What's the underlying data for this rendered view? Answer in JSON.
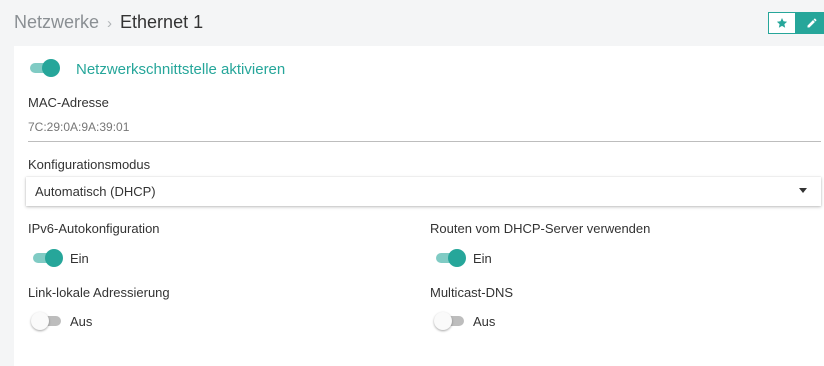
{
  "header": {
    "breadcrumb_root": "Netzwerke",
    "breadcrumb_separator": "›",
    "breadcrumb_current": "Ethernet 1",
    "actions": [
      {
        "name": "favorite",
        "icon": "star-icon"
      },
      {
        "name": "edit",
        "icon": "pencil-icon"
      }
    ]
  },
  "colors": {
    "accent": "#26a69a",
    "accent_light": "#80cbc4",
    "toggle_off": "#bdbdbd"
  },
  "interface": {
    "enable_label": "Netzwerkschnittstelle aktivieren",
    "enabled": true
  },
  "mac": {
    "label": "MAC-Adresse",
    "value": "7C:29:0A:9A:39:01"
  },
  "config_mode": {
    "label": "Konfigurationsmodus",
    "selected": "Automatisch (DHCP)"
  },
  "options": {
    "ipv6": {
      "label": "IPv6-Autokonfiguration",
      "enabled": true,
      "state_text": "Ein"
    },
    "dhcp_routes": {
      "label": "Routen vom DHCP-Server verwenden",
      "enabled": true,
      "state_text": "Ein"
    },
    "link_local": {
      "label": "Link-lokale Adressierung",
      "enabled": false,
      "state_text": "Aus"
    },
    "mdns": {
      "label": "Multicast-DNS",
      "enabled": false,
      "state_text": "Aus"
    }
  }
}
